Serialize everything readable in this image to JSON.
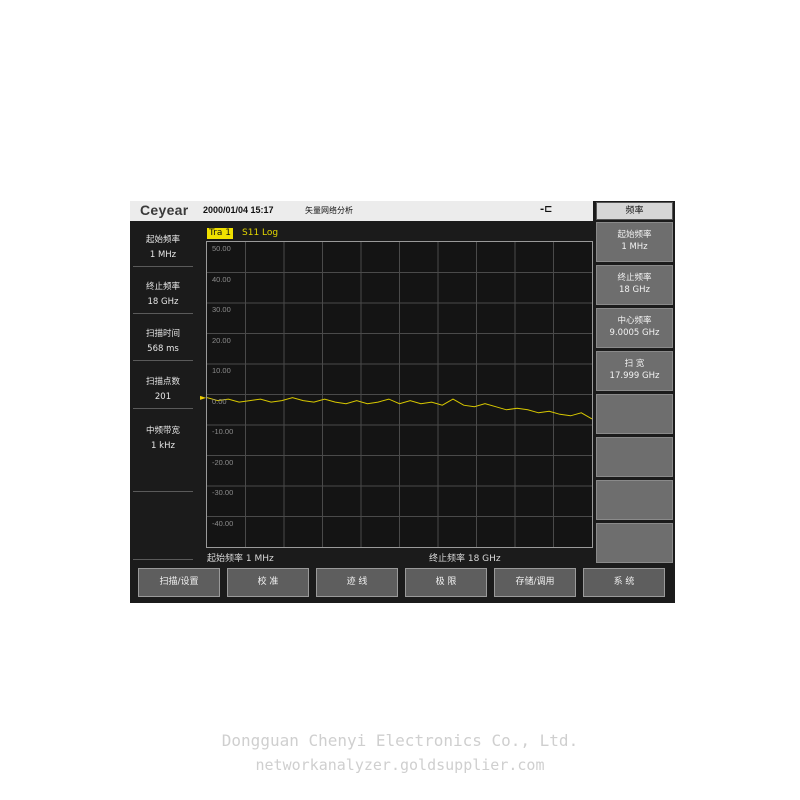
{
  "header": {
    "logo": "Ceyear",
    "datetime": "2000/01/04 15:17",
    "app_title": "矢量网络分析",
    "power_icon": "plug-icon",
    "menu_title": "频率"
  },
  "left_params": [
    {
      "label": "起始频率",
      "value": "1 MHz"
    },
    {
      "label": "终止频率",
      "value": "18 GHz"
    },
    {
      "label": "扫描时间",
      "value": "568 ms"
    },
    {
      "label": "扫描点数",
      "value": "201"
    },
    {
      "label": "中频带宽",
      "value": "1 kHz"
    }
  ],
  "trace": {
    "label": "Tra 1",
    "format": "S11 Log",
    "color": "#d8c800",
    "start": "起始频率 1 MHz",
    "stop": "终止频率 18 GHz"
  },
  "y_ticks": [
    "50.00",
    "40.00",
    "30.00",
    "20.00",
    "10.00",
    "0.00",
    "-10.00",
    "-20.00",
    "-30.00",
    "-40.00"
  ],
  "chart_data": {
    "type": "line",
    "ylim": [
      -50,
      50
    ],
    "xlim": [
      0.001,
      18
    ],
    "grid": true,
    "series": [
      {
        "x": [
          0.001,
          0.5,
          1.0,
          1.5,
          2.0,
          2.5,
          3.0,
          3.5,
          4.0,
          4.5,
          5.0,
          5.5,
          6.0,
          6.5,
          7.0,
          7.5,
          8.0,
          8.5,
          9.0,
          9.5,
          10.0,
          10.5,
          11.0,
          11.5,
          12.0,
          12.5,
          13.0,
          13.5,
          14.0,
          14.5,
          15.0,
          15.5,
          16.0,
          16.5,
          17.0,
          17.5,
          18.0
        ],
        "y": [
          -1.0,
          -2.0,
          -1.5,
          -2.5,
          -2.0,
          -1.5,
          -2.5,
          -2.0,
          -1.0,
          -2.0,
          -2.5,
          -1.5,
          -2.5,
          -3.0,
          -2.0,
          -3.0,
          -2.5,
          -1.5,
          -3.0,
          -2.0,
          -3.0,
          -2.5,
          -3.5,
          -1.5,
          -3.5,
          -4.0,
          -3.0,
          -4.0,
          -5.0,
          -4.5,
          -5.0,
          -6.0,
          -5.5,
          -6.5,
          -7.0,
          -6.0,
          -8.0
        ]
      }
    ]
  },
  "softkeys": [
    {
      "l1": "起始频率",
      "l2": "1 MHz"
    },
    {
      "l1": "终止频率",
      "l2": "18 GHz"
    },
    {
      "l1": "中心频率",
      "l2": "9.0005 GHz"
    },
    {
      "l1": "扫 宽",
      "l2": "17.999 GHz"
    },
    {
      "l1": "",
      "l2": ""
    },
    {
      "l1": "",
      "l2": ""
    },
    {
      "l1": "",
      "l2": ""
    },
    {
      "l1": "",
      "l2": ""
    }
  ],
  "bottom_keys": [
    "扫描/设置",
    "校 准",
    "迹 线",
    "极 限",
    "存储/调用",
    "系 统"
  ],
  "company": {
    "name": "Dongguan Chenyi Electronics Co., Ltd.",
    "url": "networkanalyzer.goldsupplier.com"
  }
}
